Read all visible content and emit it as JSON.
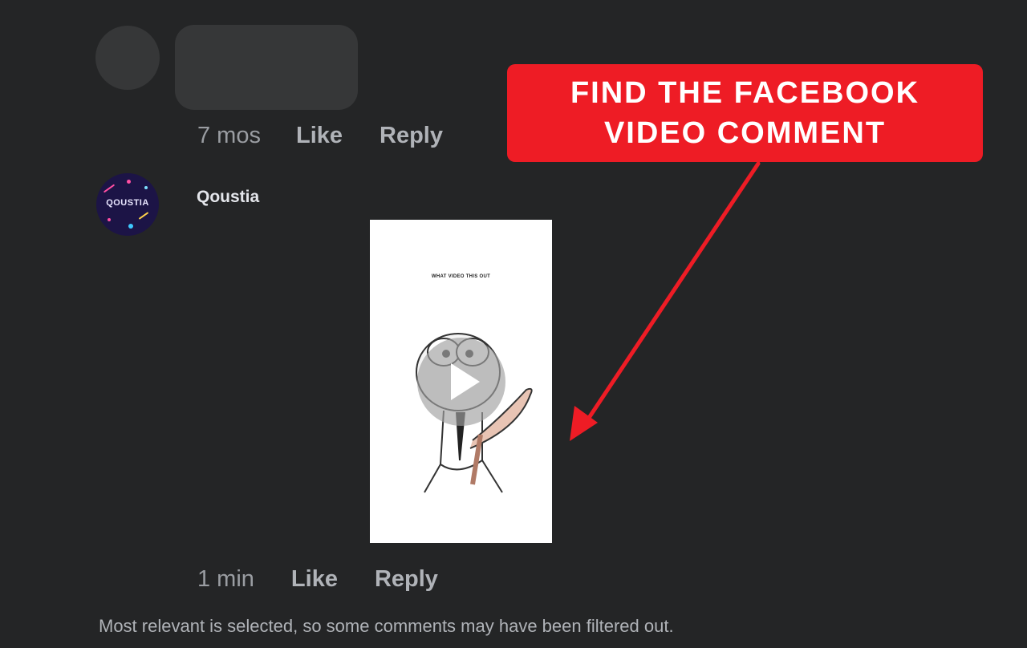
{
  "previous_comment": {
    "time": "7 mos",
    "like_label": "Like",
    "reply_label": "Reply"
  },
  "comment": {
    "author": "Qoustia",
    "avatar_text": "QOUSTIA",
    "video_caption": "WHAT VIDEO THIS OUT",
    "time": "1 min",
    "like_label": "Like",
    "reply_label": "Reply"
  },
  "footer_note": "Most relevant is selected, so some comments may have been filtered out.",
  "callout": {
    "text": "FIND THE FACEBOOK\nVIDEO COMMENT",
    "color": "#ee1c25"
  },
  "colors": {
    "background": "#242526",
    "text_primary": "#e4e6eb",
    "text_secondary": "#b0b3b8",
    "arrow": "#ee1c25"
  },
  "icons": {
    "play": "play-icon",
    "arrow": "arrow-annotation"
  }
}
